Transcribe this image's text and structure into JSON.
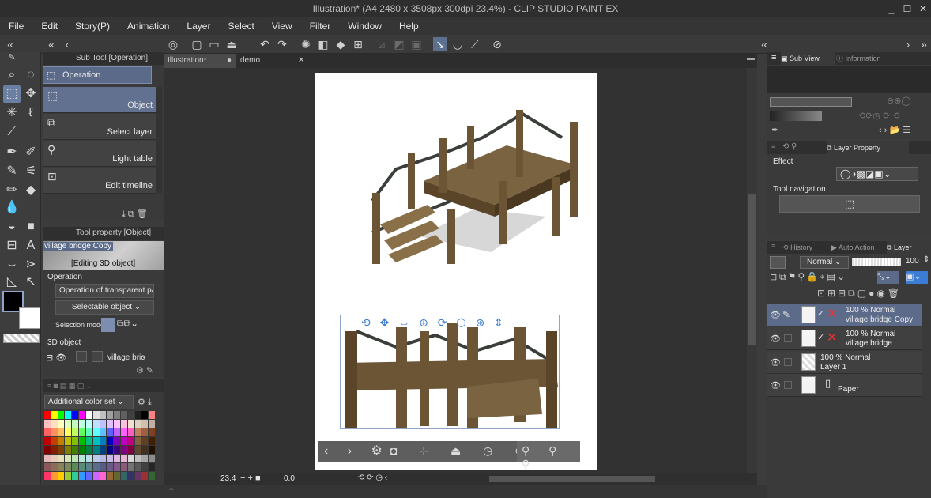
{
  "app": {
    "title": "Illustration* (A4 2480 x 3508px 300dpi 23.4%) - CLIP STUDIO PAINT EX",
    "window_controls": [
      "_",
      "☐",
      "✕"
    ]
  },
  "menu": [
    "File",
    "Edit",
    "Story(P)",
    "Animation",
    "Layer",
    "Select",
    "View",
    "Filter",
    "Window",
    "Help"
  ],
  "sub_tool": {
    "header": "Sub Tool [Operation]",
    "group_label": "Operation",
    "items": [
      "Object",
      "Select layer",
      "Light table",
      "Edit timeline"
    ]
  },
  "tool_property": {
    "header": "Tool property [Object]",
    "preview_label": "village bridge Copy",
    "editing_label": "[Editing 3D object]",
    "operation_label": "Operation",
    "operation_value": "Operation of transparent part",
    "selectable_value": "Selectable object",
    "selection_mode_label": "Selection mode",
    "object_section": "3D object",
    "object_value": "village bric"
  },
  "color_set": {
    "dropdown_value": "Additional color set",
    "colors": [
      "#ff0000",
      "#ffff00",
      "#00ff00",
      "#00ffff",
      "#0000ff",
      "#ff00ff",
      "#ffffff",
      "#e0e0e0",
      "#c0c0c0",
      "#a0a0a0",
      "#808080",
      "#606060",
      "#404040",
      "#202020",
      "#000000",
      "#ff8080",
      "#ffc0c0",
      "#ffe0c0",
      "#ffffc0",
      "#e0ffc0",
      "#c0ffc0",
      "#c0ffe0",
      "#c0ffff",
      "#c0e0ff",
      "#c0c0ff",
      "#e0c0ff",
      "#ffc0ff",
      "#ffc0e0",
      "#f0e0d0",
      "#e0d0c0",
      "#d0c0b0",
      "#c0b0a0",
      "#ff6060",
      "#ff9060",
      "#ffc060",
      "#ffff60",
      "#c0ff60",
      "#60ff60",
      "#60ffc0",
      "#60ffff",
      "#60c0ff",
      "#6060ff",
      "#c060ff",
      "#ff60ff",
      "#ff60c0",
      "#c08060",
      "#a06040",
      "#804020",
      "#c00000",
      "#c04000",
      "#c08000",
      "#c0c000",
      "#80c000",
      "#00c000",
      "#00c080",
      "#00c0c0",
      "#0080c0",
      "#0000c0",
      "#8000c0",
      "#c000c0",
      "#c00080",
      "#806040",
      "#604020",
      "#402000",
      "#800000",
      "#802000",
      "#804000",
      "#808000",
      "#408000",
      "#008000",
      "#008040",
      "#008080",
      "#004080",
      "#000080",
      "#400080",
      "#800080",
      "#800040",
      "#604830",
      "#403020",
      "#201000",
      "#e6b8b8",
      "#e6ccb8",
      "#e6e0b8",
      "#d6e6b8",
      "#b8e6b8",
      "#b8e6d6",
      "#b8e0e6",
      "#b8cce6",
      "#b8b8e6",
      "#ccb8e6",
      "#e0b8e6",
      "#e6b8d6",
      "#d9d9d9",
      "#bfbfbf",
      "#a6a6a6",
      "#8c8c8c",
      "#8a5a5a",
      "#8a6e5a",
      "#8a825a",
      "#7a8a5a",
      "#5a8a5a",
      "#5a8a7a",
      "#5a828a",
      "#5a6e8a",
      "#5a5a8a",
      "#6e5a8a",
      "#825a8a",
      "#8a5a7a",
      "#737373",
      "#595959",
      "#404040",
      "#262626",
      "#ff3366",
      "#ff9933",
      "#ffcc00",
      "#99cc33",
      "#33cc99",
      "#3399ff",
      "#6666ff",
      "#cc66ff",
      "#ff66cc",
      "#996633",
      "#666633",
      "#336666",
      "#333366",
      "#663366",
      "#993333",
      "#336633"
    ],
    "bottom_swatches": [
      "#cc0000",
      "#00aa00",
      "#0000cc"
    ]
  },
  "canvas": {
    "tabs": [
      "Illustration*",
      "demo"
    ],
    "zoom": "23.4",
    "angle": "0.0"
  },
  "right": {
    "sub_view_tabs": [
      "Sub View",
      "Information"
    ],
    "layer_property_tab": "Layer Property",
    "effect_label": "Effect",
    "tool_nav_label": "Tool navigation",
    "layer_tabs": [
      "History",
      "Auto Action",
      "Layer"
    ],
    "blend_mode": "Normal",
    "opacity": "100",
    "layers": [
      {
        "line1": "100 % Normal",
        "line2": "village bridge Copy",
        "selected": true,
        "has_x": true
      },
      {
        "line1": "100 % Normal",
        "line2": "village bridge",
        "selected": false,
        "has_x": true
      },
      {
        "line1": "100 % Normal",
        "line2": "Layer 1",
        "selected": false,
        "has_x": false
      },
      {
        "line1": "",
        "line2": "Paper",
        "selected": false,
        "has_x": false
      }
    ]
  },
  "colors": {
    "accent": "#6b7fa3",
    "selection": "#5c6b8a",
    "panel": "#3a3a3a"
  }
}
